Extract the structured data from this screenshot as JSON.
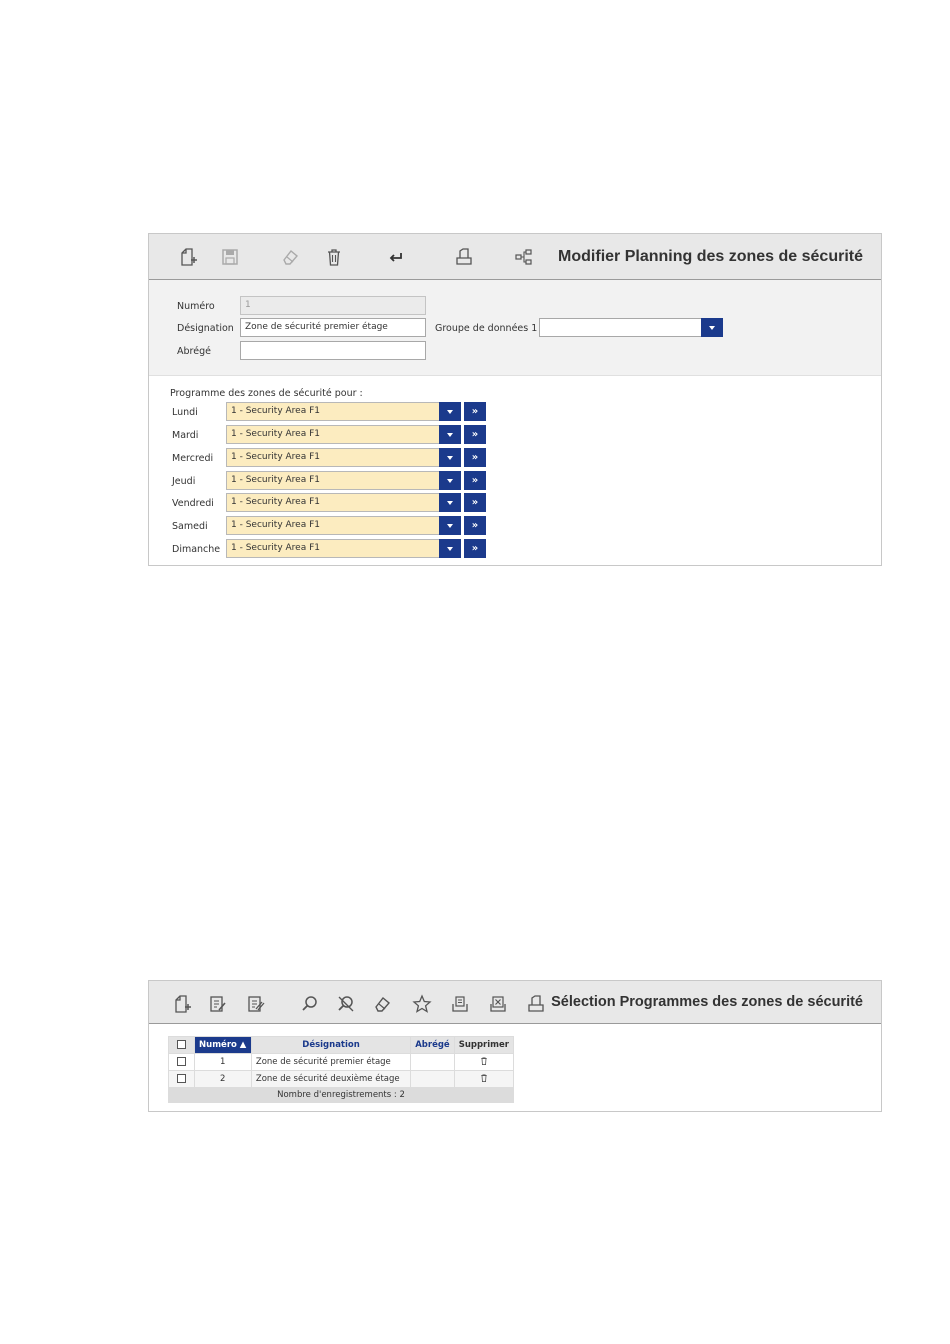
{
  "edit_form": {
    "title": "Modifier Planning des zones de sécurité",
    "toolbar_icons": [
      "new-icon",
      "save-icon",
      "eraser-icon",
      "trash-icon",
      "return-icon",
      "print-icon",
      "hierarchy-icon"
    ],
    "fields": {
      "numero_label": "Numéro",
      "numero_value": "1",
      "designation_label": "Désignation",
      "designation_value": "Zone de sécurité premier étage",
      "abrege_label": "Abrégé",
      "abrege_value": "",
      "groupe_label": "Groupe de données 1",
      "groupe_value": ""
    },
    "programme_heading": "Programme des zones de sécurité pour :",
    "days": [
      {
        "label": "Lundi",
        "value": "1 - Security Area F1"
      },
      {
        "label": "Mardi",
        "value": "1 - Security Area F1"
      },
      {
        "label": "Mercredi",
        "value": "1 - Security Area F1"
      },
      {
        "label": "Jeudi",
        "value": "1 - Security Area F1"
      },
      {
        "label": "Vendredi",
        "value": "1 - Security Area F1"
      },
      {
        "label": "Samedi",
        "value": "1 - Security Area F1"
      },
      {
        "label": "Dimanche",
        "value": "1 - Security Area F1"
      }
    ],
    "jump_symbol": "»",
    "colors": {
      "accent": "#1b3a8c",
      "schedule_field": "#fcecc0"
    }
  },
  "selection": {
    "title": "Sélection Programmes des zones de sécurité",
    "toolbar_icons": [
      "new-icon",
      "edit-icon",
      "edit-multiple-icon",
      "search-icon",
      "clear-search-icon",
      "eraser-icon",
      "favorite-icon",
      "export-icon",
      "excel-icon",
      "print-icon"
    ],
    "columns": [
      "Numéro ▲",
      "Désignation",
      "Abrégé",
      "Supprimer"
    ],
    "rows": [
      {
        "numero": "1",
        "designation": "Zone de sécurité premier étage",
        "abrege": ""
      },
      {
        "numero": "2",
        "designation": "Zone de sécurité deuxième étage",
        "abrege": ""
      }
    ],
    "footer": "Nombre d'enregistrements : 2"
  }
}
